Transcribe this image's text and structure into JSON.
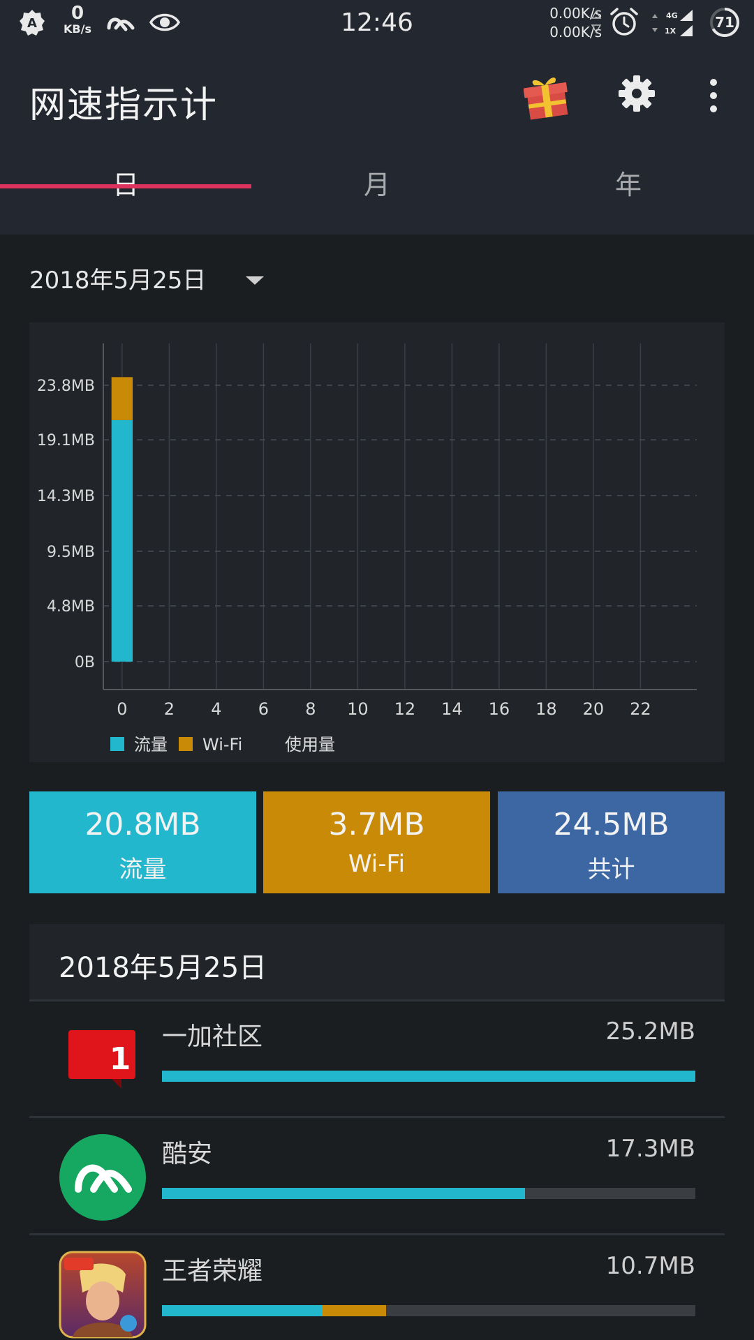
{
  "status_bar": {
    "speed_num": "0",
    "speed_unit": "KB/s",
    "time": "12:46",
    "up_speed": "0.00K/s",
    "down_speed": "0.00K/s",
    "net_4g": "4G",
    "net_1x": "1X",
    "battery": "71",
    "icons": [
      "a-badge-icon",
      "coolapk-icon",
      "eye-icon",
      "alarm-icon",
      "signal-icon",
      "battery-icon"
    ]
  },
  "app_bar": {
    "title": "网速指示计",
    "icons": [
      "gift-icon",
      "gear-icon",
      "more-vert-icon"
    ]
  },
  "tabs": [
    {
      "label": "日",
      "active": true
    },
    {
      "label": "月",
      "active": false
    },
    {
      "label": "年",
      "active": false
    }
  ],
  "date_selector": {
    "value": "2018年5月25日"
  },
  "chart_data": {
    "type": "bar",
    "stacked": true,
    "x": [
      0,
      1,
      2,
      3,
      4,
      5,
      6,
      7,
      8,
      9,
      10,
      11,
      12,
      13,
      14,
      15,
      16,
      17,
      18,
      19,
      20,
      21,
      22,
      23
    ],
    "x_tick_labels": [
      "0",
      "2",
      "4",
      "6",
      "8",
      "10",
      "12",
      "14",
      "16",
      "18",
      "20",
      "22"
    ],
    "y_tick_labels": [
      "0B",
      "4.8MB",
      "9.5MB",
      "14.3MB",
      "19.1MB",
      "23.8MB"
    ],
    "y_ticks": [
      0,
      4.8,
      9.5,
      14.3,
      19.1,
      23.8
    ],
    "ylim": [
      0,
      24
    ],
    "y_unit": "MB",
    "series": [
      {
        "name": "流量",
        "color": "#22b7cc",
        "values": [
          20.8,
          0,
          0,
          0,
          0,
          0,
          0,
          0,
          0,
          0,
          0,
          0,
          0,
          0,
          0,
          0,
          0,
          0,
          0,
          0,
          0,
          0,
          0,
          0
        ]
      },
      {
        "name": "Wi-Fi",
        "color": "#c98a08",
        "values": [
          3.7,
          0,
          0,
          0,
          0,
          0,
          0,
          0,
          0,
          0,
          0,
          0,
          0,
          0,
          0,
          0,
          0,
          0,
          0,
          0,
          0,
          0,
          0,
          0
        ]
      }
    ],
    "legend": {
      "position": "bottom-left",
      "mobile_label": "流量",
      "wifi_label": "Wi-Fi",
      "suffix_label": "使用量"
    },
    "grid": true
  },
  "summary": [
    {
      "value": "20.8MB",
      "label": "流量",
      "color": "#22b7cc"
    },
    {
      "value": "3.7MB",
      "label": "Wi-Fi",
      "color": "#c98a08"
    },
    {
      "value": "24.5MB",
      "label": "共计",
      "color": "#3d67a3"
    }
  ],
  "usage_list": {
    "header": "2018年5月25日",
    "items": [
      {
        "name": "一加社区",
        "size": "25.2MB",
        "icon": "oneplus-community-icon",
        "badge": "1",
        "mobile_fraction": 1.0,
        "wifi_fraction": 0.0
      },
      {
        "name": "酷安",
        "size": "17.3MB",
        "icon": "coolapk-app-icon",
        "mobile_fraction": 0.68,
        "wifi_fraction": 0.0
      },
      {
        "name": "王者荣耀",
        "size": "10.7MB",
        "icon": "honor-of-kings-icon",
        "mobile_fraction": 0.3,
        "wifi_fraction": 0.12
      }
    ]
  }
}
